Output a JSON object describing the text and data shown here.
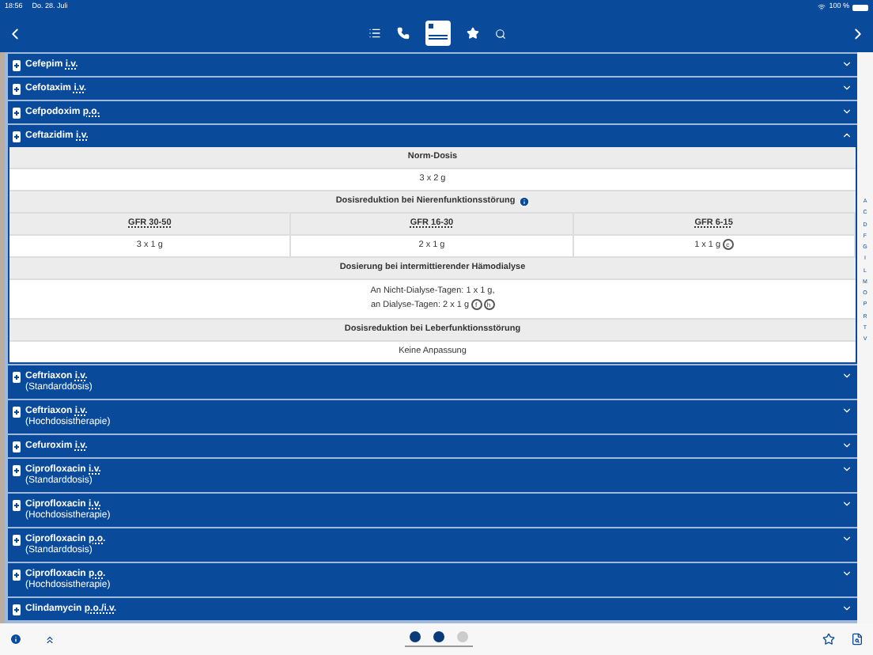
{
  "status_bar": {
    "time": "18:56",
    "date": "Do. 28. Juli",
    "battery": "100 %"
  },
  "drugs": [
    {
      "name": "Cefepim",
      "route": "i.v.",
      "expanded": false
    },
    {
      "name": "Cefotaxim",
      "route": "i.v.",
      "expanded": false
    },
    {
      "name": "Cefpodoxim",
      "route": "p.o.",
      "expanded": false
    },
    {
      "name": "Ceftazidim",
      "route": "i.v.",
      "expanded": true,
      "details": {
        "norm_heading": "Norm-Dosis",
        "norm_value": "3 x 2 g",
        "renal_heading": "Dosisreduktion bei Nierenfunktionsstörung",
        "gfr_columns": [
          {
            "label": "GFR 30-50",
            "value": "3 x 1 g"
          },
          {
            "label": "GFR 16-30",
            "value": "2 x 1 g"
          },
          {
            "label": "GFR 6-15",
            "value": "1 x 1 g",
            "badges": [
              "c"
            ]
          }
        ],
        "dialysis_heading": "Dosierung bei intermittierender Hämodialyse",
        "dialysis_lines": [
          {
            "text": "An Nicht-Dialyse-Tagen: 1 x 1 g,"
          },
          {
            "text": "an Dialyse-Tagen: 2 x 1 g",
            "badges": [
              "f",
              "h"
            ]
          }
        ],
        "liver_heading": "Dosisreduktion bei Leberfunktionsstörung",
        "liver_value": "Keine Anpassung"
      }
    },
    {
      "name": "Ceftriaxon",
      "route": "i.v.",
      "subtitle": "(Standarddosis)",
      "expanded": false
    },
    {
      "name": "Ceftriaxon",
      "route": "i.v.",
      "subtitle": "(Hochdosistherapie)",
      "expanded": false
    },
    {
      "name": "Cefuroxim",
      "route": "i.v.",
      "expanded": false
    },
    {
      "name": "Ciprofloxacin",
      "route": "i.v.",
      "subtitle": "(Standarddosis)",
      "expanded": false
    },
    {
      "name": "Ciprofloxacin",
      "route": "i.v.",
      "subtitle": "(Hochdosistherapie)",
      "expanded": false
    },
    {
      "name": "Ciprofloxacin",
      "route": "p.o.",
      "subtitle": "(Standarddosis)",
      "expanded": false
    },
    {
      "name": "Ciprofloxacin",
      "route": "p.o.",
      "subtitle": "(Hochdosistherapie)",
      "expanded": false
    },
    {
      "name": "Clindamycin",
      "route": "p.o./i.v.",
      "expanded": false
    }
  ],
  "index_letters": [
    "A",
    "C",
    "D",
    "F",
    "G",
    "I",
    "L",
    "M",
    "O",
    "P",
    "R",
    "T",
    "V"
  ],
  "pager": [
    {
      "selected": true
    },
    {
      "selected": true
    },
    {
      "selected": false
    }
  ]
}
